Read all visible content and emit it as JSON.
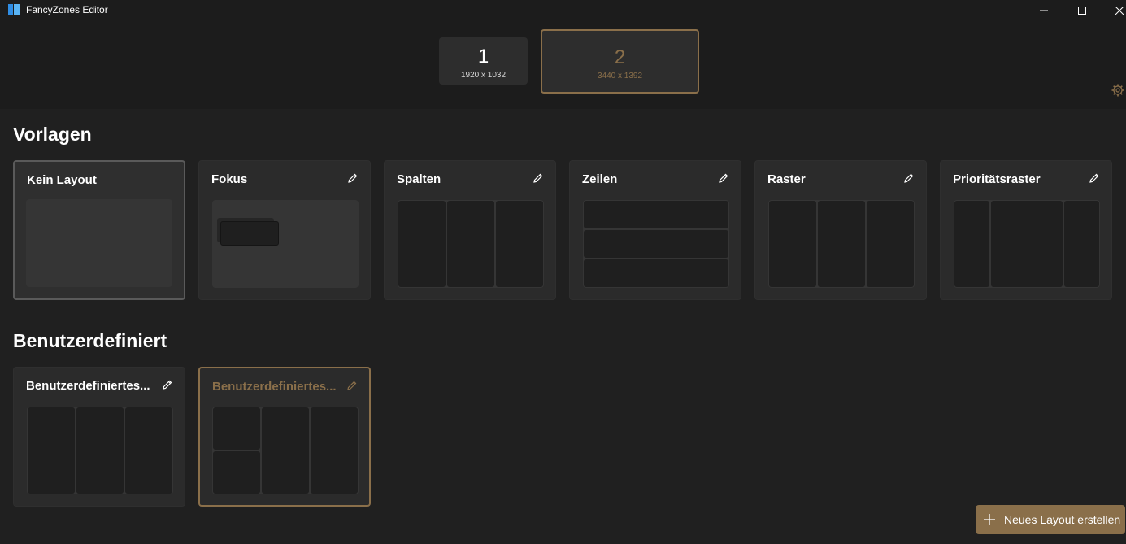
{
  "window": {
    "title": "FancyZones Editor",
    "icon": "fancyzones-icon"
  },
  "monitors": [
    {
      "number": "1",
      "resolution": "1920 x 1032",
      "selected": false
    },
    {
      "number": "2",
      "resolution": "3440 x 1392",
      "selected": true
    }
  ],
  "sections": {
    "templates_title": "Vorlagen",
    "custom_title": "Benutzerdefiniert"
  },
  "templates": [
    {
      "name": "Kein Layout",
      "editable": false,
      "active": true
    },
    {
      "name": "Fokus",
      "editable": true
    },
    {
      "name": "Spalten",
      "editable": true
    },
    {
      "name": "Zeilen",
      "editable": true
    },
    {
      "name": "Raster",
      "editable": true
    },
    {
      "name": "Prioritätsraster",
      "editable": true
    }
  ],
  "custom_layouts": [
    {
      "name": "Benutzerdefiniertes...",
      "editable": true,
      "selected": false
    },
    {
      "name": "Benutzerdefiniertes...",
      "editable": true,
      "selected": true
    }
  ],
  "actions": {
    "new_layout_label": "Neues Layout erstellen"
  },
  "colors": {
    "accent": "#8a6f4a",
    "background": "#202020",
    "card": "#2b2b2b",
    "zone": "#1f1f1f"
  }
}
